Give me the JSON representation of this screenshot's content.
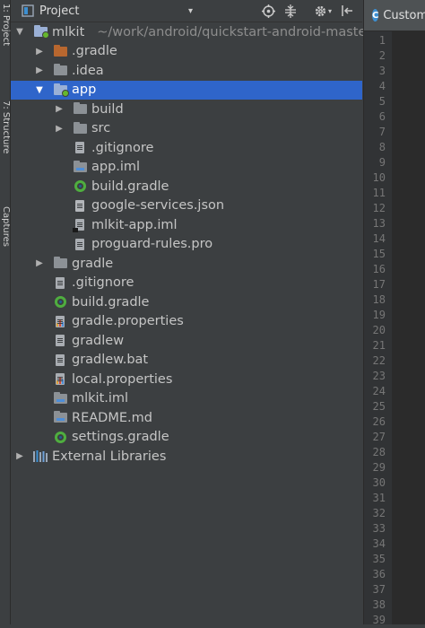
{
  "side_tabs": [
    "1: Project",
    "7: Structure",
    "Captures"
  ],
  "panel": {
    "title": "Project",
    "dropdown_glyph": "▾",
    "icons": {
      "project": "project-view-icon",
      "target": "locate-file-icon",
      "collapse": "collapse-all-icon",
      "gear": "gear-icon",
      "hide": "hide-panel-icon"
    }
  },
  "tree": [
    {
      "label": "mlkit",
      "hint": "~/work/android/quickstart-android-master/mlkit",
      "depth": 0,
      "arrow": "▼",
      "icon": "folder-module-icon",
      "selected": false
    },
    {
      "label": ".gradle",
      "depth": 1,
      "arrow": "▶",
      "icon": "folder-orange-icon",
      "selected": false
    },
    {
      "label": ".idea",
      "depth": 1,
      "arrow": "▶",
      "icon": "folder-icon",
      "selected": false
    },
    {
      "label": "app",
      "depth": 1,
      "arrow": "▼",
      "icon": "folder-module-icon",
      "selected": true
    },
    {
      "label": "build",
      "depth": 2,
      "arrow": "▶",
      "icon": "folder-icon",
      "selected": false
    },
    {
      "label": "src",
      "depth": 2,
      "arrow": "▶",
      "icon": "folder-icon",
      "selected": false
    },
    {
      "label": ".gitignore",
      "depth": 2,
      "arrow": "",
      "icon": "text-file-icon",
      "selected": false
    },
    {
      "label": "app.iml",
      "depth": 2,
      "arrow": "",
      "icon": "iml-file-icon",
      "selected": false
    },
    {
      "label": "build.gradle",
      "depth": 2,
      "arrow": "",
      "icon": "gradle-icon",
      "selected": false
    },
    {
      "label": "google-services.json",
      "depth": 2,
      "arrow": "",
      "icon": "json-file-icon",
      "selected": false
    },
    {
      "label": "mlkit-app.iml",
      "depth": 2,
      "arrow": "",
      "icon": "iml-file-modified-icon",
      "selected": false
    },
    {
      "label": "proguard-rules.pro",
      "depth": 2,
      "arrow": "",
      "icon": "text-file-icon",
      "selected": false
    },
    {
      "label": "gradle",
      "depth": 1,
      "arrow": "▶",
      "icon": "folder-icon",
      "selected": false
    },
    {
      "label": ".gitignore",
      "depth": 1,
      "arrow": "",
      "icon": "text-file-icon",
      "selected": false
    },
    {
      "label": "build.gradle",
      "depth": 1,
      "arrow": "",
      "icon": "gradle-icon",
      "selected": false
    },
    {
      "label": "gradle.properties",
      "depth": 1,
      "arrow": "",
      "icon": "properties-file-icon",
      "selected": false
    },
    {
      "label": "gradlew",
      "depth": 1,
      "arrow": "",
      "icon": "text-file-icon",
      "selected": false
    },
    {
      "label": "gradlew.bat",
      "depth": 1,
      "arrow": "",
      "icon": "text-file-icon",
      "selected": false
    },
    {
      "label": "local.properties",
      "depth": 1,
      "arrow": "",
      "icon": "properties-file-icon",
      "selected": false
    },
    {
      "label": "mlkit.iml",
      "depth": 1,
      "arrow": "",
      "icon": "iml-folder-icon",
      "selected": false
    },
    {
      "label": "README.md",
      "depth": 1,
      "arrow": "",
      "icon": "markdown-file-icon",
      "selected": false
    },
    {
      "label": "settings.gradle",
      "depth": 1,
      "arrow": "",
      "icon": "gradle-icon",
      "selected": false
    },
    {
      "label": "External Libraries",
      "depth": 0,
      "arrow": "▶",
      "icon": "libraries-icon",
      "selected": false
    }
  ],
  "editor": {
    "tab_label": "CustomImageAnalyzer",
    "tab_icon_letter": "C",
    "line_numbers": [
      "1",
      "2",
      "3",
      "4",
      "5",
      "6",
      "7",
      "8",
      "9",
      "10",
      "11",
      "12",
      "13",
      "14",
      "15",
      "16",
      "17",
      "18",
      "19",
      "20",
      "21",
      "22",
      "23",
      "24",
      "25",
      "26",
      "27",
      "28",
      "29",
      "30",
      "31",
      "32",
      "33",
      "34",
      "35",
      "36",
      "37",
      "38",
      "39"
    ]
  },
  "colors": {
    "panel_bg": "#3c3f41",
    "selection": "#2f65ca",
    "editor_bg": "#2b2b2b",
    "gutter_bg": "#313335"
  }
}
